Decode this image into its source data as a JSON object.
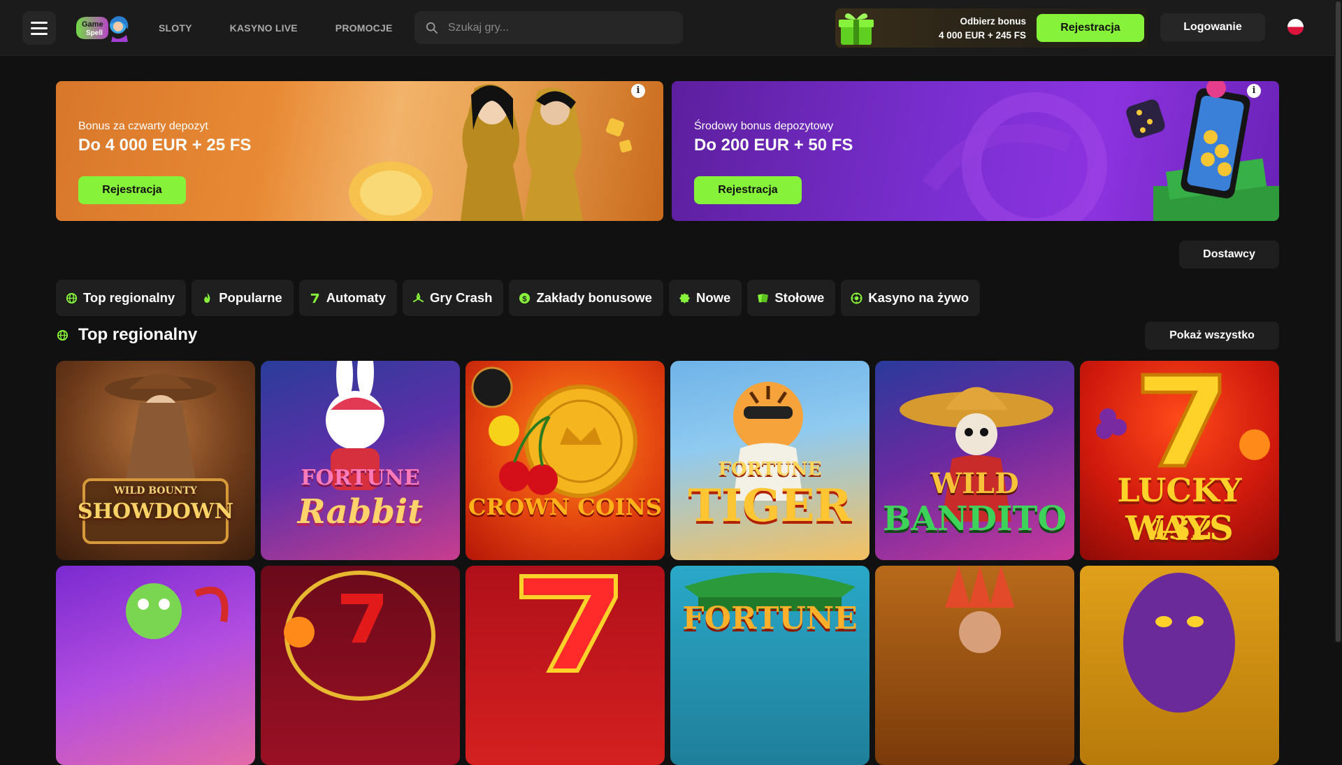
{
  "header": {
    "nav": [
      "SLOTY",
      "KASYNO LIVE",
      "PROMOCJE"
    ],
    "search_placeholder": "Szukaj gry...",
    "bonus_line1": "Odbierz bonus",
    "bonus_line2": "4 000 EUR + 245 FS",
    "register_label": "Rejestracja",
    "login_label": "Logowanie",
    "logo_text": "Game Spell"
  },
  "banners": [
    {
      "subtitle": "Bonus za czwarty depozyt",
      "title": "Do 4 000 EUR + 25 FS",
      "button": "Rejestracja"
    },
    {
      "subtitle": "Środowy bonus depozytowy",
      "title": "Do 200 EUR + 50 FS",
      "button": "Rejestracja"
    }
  ],
  "providers_label": "Dostawcy",
  "categories": [
    {
      "label": "Top regionalny",
      "icon": "globe-icon"
    },
    {
      "label": "Popularne",
      "icon": "flame-icon"
    },
    {
      "label": "Automaty",
      "icon": "seven-icon"
    },
    {
      "label": "Gry Crash",
      "icon": "crash-icon"
    },
    {
      "label": "Zakłady bonusowe",
      "icon": "dollar-coin-icon"
    },
    {
      "label": "Nowe",
      "icon": "new-badge-icon"
    },
    {
      "label": "Stołowe",
      "icon": "cards-icon"
    },
    {
      "label": "Kasyno na żywo",
      "icon": "live-casino-icon"
    }
  ],
  "section": {
    "title": "Top regionalny",
    "show_all": "Pokaż wszystko"
  },
  "games_row1": [
    {
      "name": "WILD BOUNTY SHOWDOWN",
      "line1": "WILD BOUNTY",
      "line2": "SHOWDOWN"
    },
    {
      "name": "FORTUNE RABBIT",
      "line1": "FORTUNE",
      "line2": "Rabbit"
    },
    {
      "name": "CROWN COINS",
      "line1": "",
      "line2": "CROWN COINS"
    },
    {
      "name": "FORTUNE TIGER",
      "line1": "FORTUNE",
      "line2": "TIGER"
    },
    {
      "name": "WILD BANDITO",
      "line1": "WILD",
      "line2": "BANDITO"
    },
    {
      "name": "LUCKY 432 WAYS",
      "line1": "LUCKY 432",
      "line2": "WAYS"
    }
  ],
  "games_row2": [
    {
      "name": "",
      "line1": ""
    },
    {
      "name": "",
      "line1": ""
    },
    {
      "name": "",
      "line1": ""
    },
    {
      "name": "FORTUNE",
      "line1": "FORTUNE"
    },
    {
      "name": "",
      "line1": ""
    },
    {
      "name": "",
      "line1": ""
    }
  ],
  "colors": {
    "accent": "#86f33a",
    "bg": "#111111",
    "panel": "#1f1f1f"
  }
}
